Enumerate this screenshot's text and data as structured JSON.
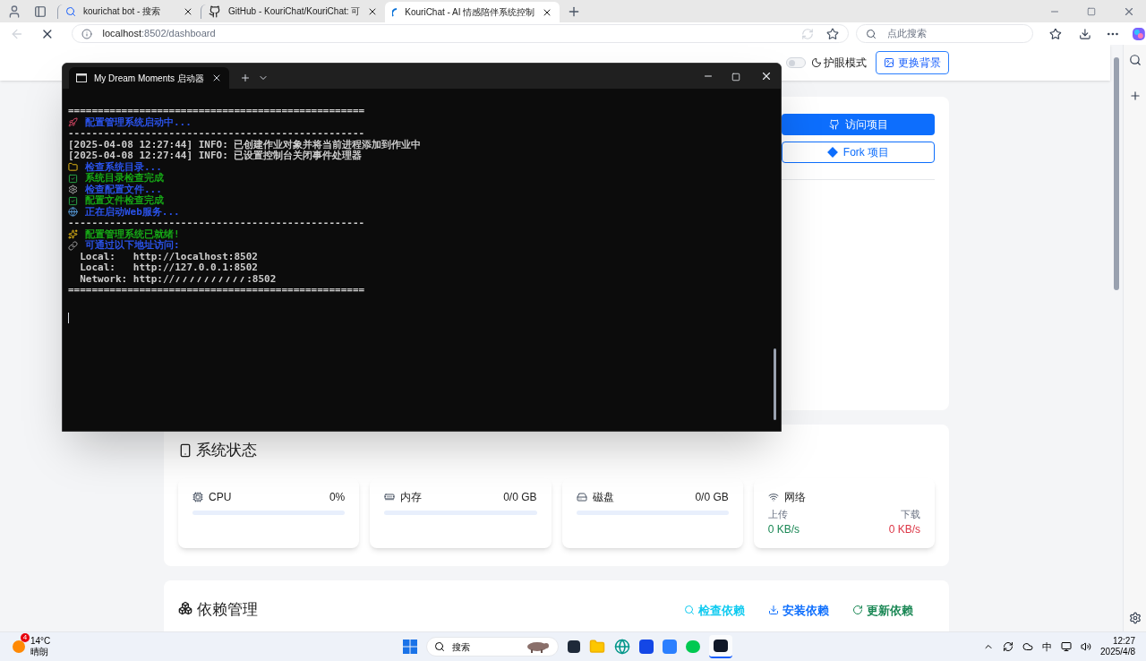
{
  "browser": {
    "tabs": [
      {
        "title": "kourichat bot - 搜索",
        "kind": "search",
        "selected": false
      },
      {
        "title": "GitHub - KouriChat/KouriChat: 可",
        "kind": "github",
        "selected": false
      },
      {
        "title": "KouriChat - AI 情感陪伴系统控制",
        "kind": "loading",
        "selected": true
      }
    ],
    "address": {
      "host": "localhost",
      "path": ":8502/dashboard"
    },
    "search": {
      "placeholder": "点此搜索"
    }
  },
  "navbar": {
    "eye_mode": {
      "label": "护眼模式",
      "on": false
    },
    "background_button": "更换背景"
  },
  "hero": {
    "buttons": [
      {
        "label": "访问项目",
        "kind": "primary"
      },
      {
        "label": "Fork 项目",
        "kind": "outline"
      }
    ]
  },
  "system_status": {
    "title": "系统状态",
    "meters": [
      {
        "name": "CPU",
        "kind": "cpu",
        "reading": "0%",
        "level": 0
      },
      {
        "name": "内存",
        "kind": "memory",
        "reading": "0/0 GB",
        "level": 0
      },
      {
        "name": "磁盘",
        "kind": "disk",
        "reading": "0/0 GB",
        "level": 0
      }
    ],
    "network": {
      "name": "网络",
      "upload_label": "上传",
      "upload": "0 KB/s",
      "download_label": "下载",
      "download": "0 KB/s"
    }
  },
  "dependencies": {
    "title": "依赖管理",
    "actions": [
      {
        "label": "检查依赖",
        "kind": "check",
        "color": "#0dcaf0"
      },
      {
        "label": "安装依赖",
        "kind": "install",
        "color": "#0d6efd"
      },
      {
        "label": "更新依赖",
        "kind": "update",
        "color": "#198754"
      }
    ]
  },
  "terminal": {
    "tab_title": "My Dream Moments 启动器",
    "lines": [
      {
        "kind": "separator",
        "text": "==================================================",
        "color": "#cccccc"
      },
      {
        "kind": "launch",
        "text": "配置管理系统启动中...",
        "color": "#2a52e8"
      },
      {
        "kind": "separator",
        "text": "--------------------------------------------------",
        "color": "#cccccc"
      },
      {
        "kind": "plain",
        "text": "[2025-04-08 12:27:44] INFO: 已创建作业对象并将当前进程添加到作业中",
        "color": "#cccccc"
      },
      {
        "kind": "plain",
        "text": "[2025-04-08 12:27:44] INFO: 已设置控制台关闭事件处理器",
        "color": "#cccccc"
      },
      {
        "kind": "folder",
        "text": "检查系统目录...",
        "color": "#2a52e8"
      },
      {
        "kind": "done",
        "text": "系统目录检查完成",
        "color": "#16a516"
      },
      {
        "kind": "config",
        "text": "检查配置文件...",
        "color": "#2a52e8"
      },
      {
        "kind": "done",
        "text": "配置文件检查完成",
        "color": "#16a516"
      },
      {
        "kind": "web",
        "text": "正在启动Web服务...",
        "color": "#2a52e8"
      },
      {
        "kind": "separator",
        "text": "--------------------------------------------------",
        "color": "#cccccc"
      },
      {
        "kind": "ready",
        "text": "配置管理系统已就绪!",
        "color": "#16a516"
      },
      {
        "kind": "link",
        "text": "可通过以下地址访问:",
        "color": "#2a52e8"
      },
      {
        "kind": "plain",
        "text": "  Local:   http://localhost:8502",
        "color": "#cccccc"
      },
      {
        "kind": "plain",
        "text": "  Local:   http://127.0.0.1:8502",
        "color": "#cccccc"
      },
      {
        "kind": "redacted",
        "before": "  Network: http://",
        "after": ":8502",
        "color": "#cccccc"
      },
      {
        "kind": "separator",
        "text": "==================================================",
        "color": "#cccccc"
      }
    ]
  },
  "taskbar": {
    "weather": {
      "temperature": "14°C",
      "condition": "晴朗",
      "badge": "4"
    },
    "search": "搜索",
    "ime": "中",
    "time": "12:27",
    "date": "2025/4/8"
  }
}
